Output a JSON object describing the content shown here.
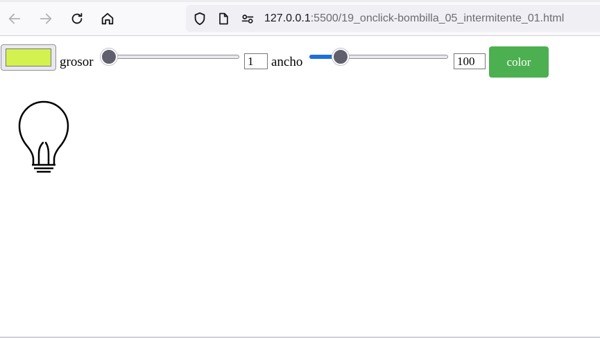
{
  "browser": {
    "url_host": "127.0.0.1",
    "url_path": ":5500/19_onclick-bombilla_05_intermitente_01.html",
    "icons": [
      "back-arrow-icon",
      "forward-arrow-icon",
      "reload-icon",
      "home-icon",
      "shield-icon",
      "page-icon",
      "permissions-icon"
    ]
  },
  "controls": {
    "color_value": "#d4f24f",
    "grosor_label": "grosor",
    "grosor_value": "1",
    "grosor_level": 0.0,
    "ancho_label": "ancho",
    "ancho_value": "100",
    "ancho_level": 0.19,
    "color_button_label": "color",
    "color_button_bg": "#4caf50"
  },
  "bulb": {
    "icon": "lightbulb-icon",
    "stroke": "#000000"
  }
}
